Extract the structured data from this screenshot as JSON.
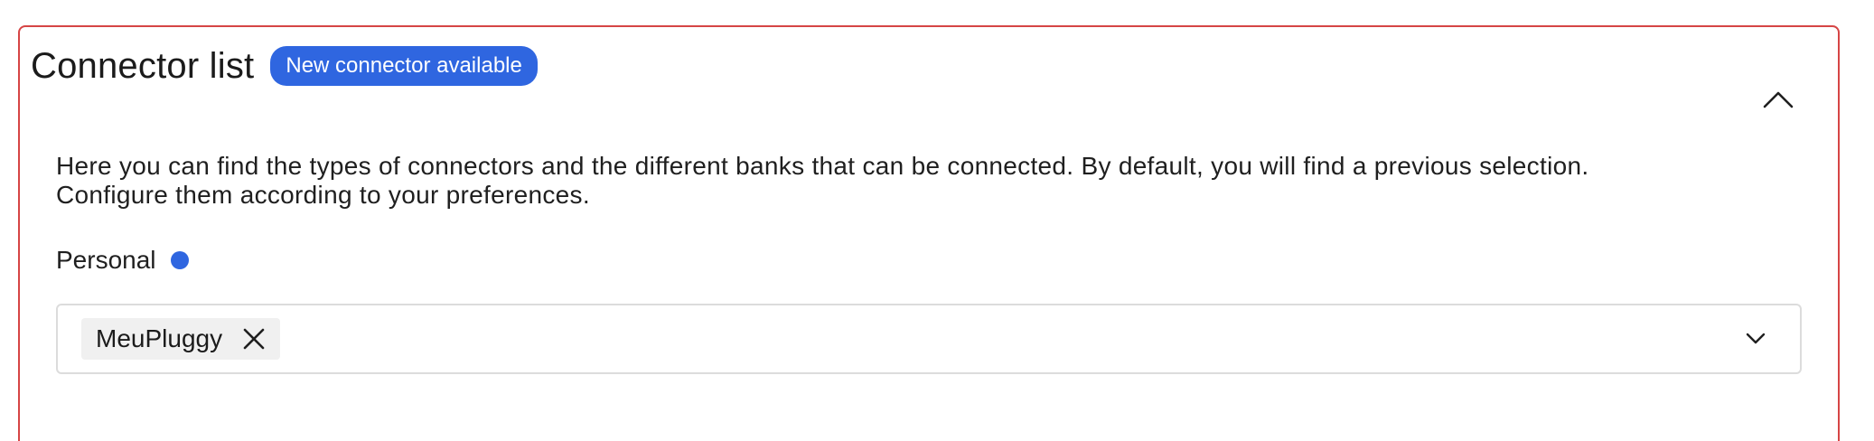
{
  "section": {
    "title": "Connector list",
    "badge": "New connector available",
    "description_lines": [
      "Here you can find the types of connectors and the different banks that can be connected. By default, you will find a previous selection.",
      "Configure them according to your preferences."
    ]
  },
  "personal": {
    "label": "Personal",
    "selected_chips": [
      {
        "label": "MeuPluggy"
      }
    ]
  },
  "colors": {
    "accent": "#2f66e0",
    "panel_border": "#d64545"
  },
  "icons": {
    "collapse": "chevron-up-icon",
    "remove": "close-icon",
    "dropdown": "chevron-down-icon"
  }
}
